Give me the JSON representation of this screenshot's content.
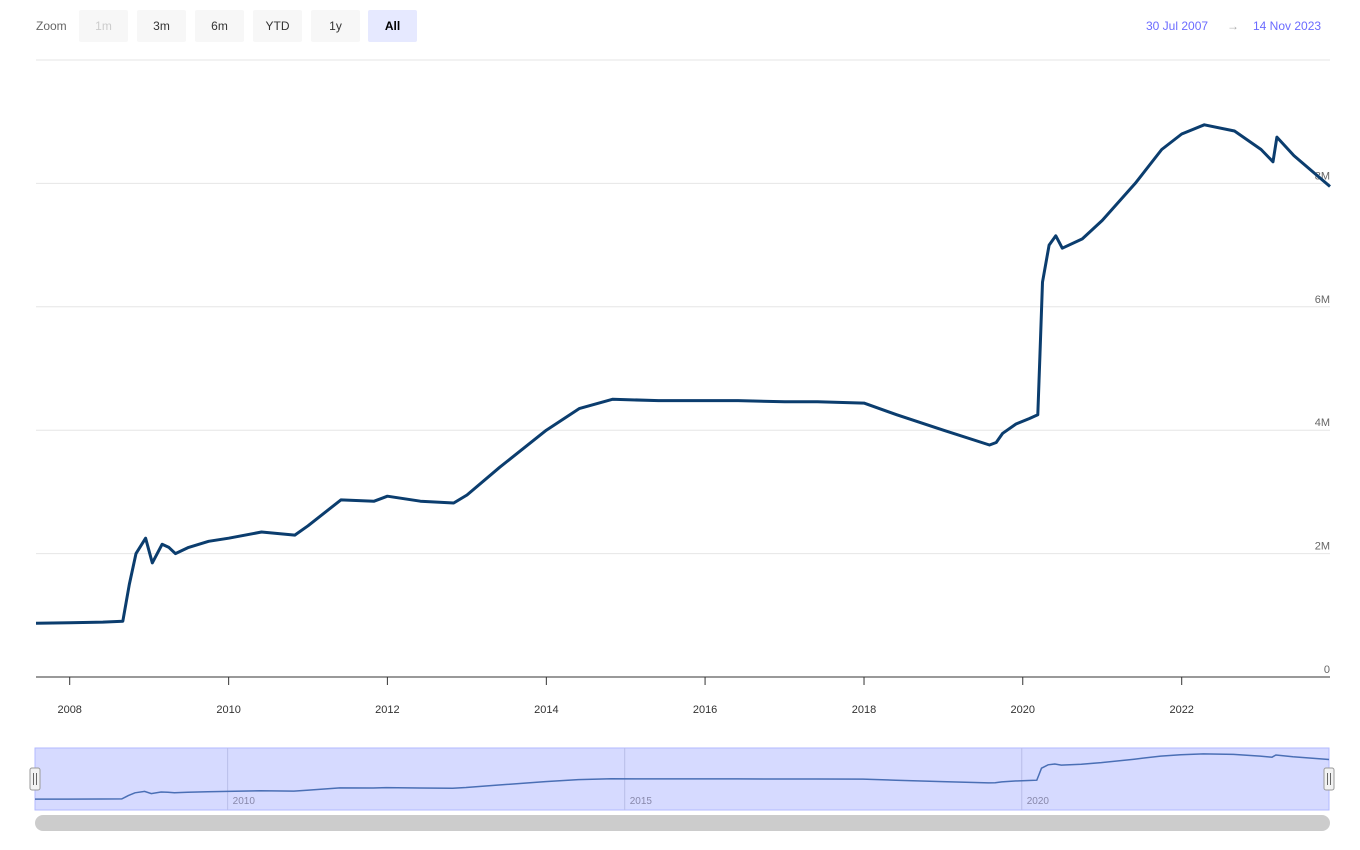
{
  "range_selector": {
    "zoom_label": "Zoom",
    "buttons": [
      {
        "label": "1m",
        "state": "disabled"
      },
      {
        "label": "3m",
        "state": "normal"
      },
      {
        "label": "6m",
        "state": "normal"
      },
      {
        "label": "YTD",
        "state": "normal"
      },
      {
        "label": "1y",
        "state": "normal"
      },
      {
        "label": "All",
        "state": "active"
      }
    ],
    "from_date": "30 Jul 2007",
    "arrow": "→",
    "to_date": "14 Nov 2023"
  },
  "colors": {
    "line": "#0b3d6e",
    "grid": "#e6e6e6",
    "navigator_fill": "#d6daff",
    "navigator_line": "#4a6fb5",
    "scrollbar": "#cccccc",
    "date_text": "#6b6bff"
  },
  "chart_data": {
    "type": "line",
    "title": "",
    "xlabel": "",
    "ylabel": "",
    "x_tick_labels": [
      "2008",
      "2010",
      "2012",
      "2014",
      "2016",
      "2018",
      "2020",
      "2022"
    ],
    "y_tick_labels": [
      "0",
      "2M",
      "4M",
      "6M",
      "8M"
    ],
    "ylim": [
      0,
      10000000
    ],
    "xlim": [
      "2007-07-30",
      "2023-11-14"
    ],
    "grid": "horizontal",
    "navigator_tick_labels": [
      "2010",
      "2015",
      "2020"
    ],
    "series": [
      {
        "x": [
          "2007-07-30",
          "2008-01-01",
          "2008-06-01",
          "2008-09-01",
          "2008-10-01",
          "2008-11-01",
          "2008-12-15",
          "2009-01-15",
          "2009-03-01",
          "2009-04-01",
          "2009-05-01",
          "2009-07-01",
          "2009-10-01",
          "2010-01-01",
          "2010-06-01",
          "2010-11-01",
          "2011-01-01",
          "2011-06-01",
          "2011-11-01",
          "2012-01-01",
          "2012-06-01",
          "2012-11-01",
          "2013-01-01",
          "2013-06-01",
          "2014-01-01",
          "2014-06-01",
          "2014-11-01",
          "2015-06-01",
          "2016-01-01",
          "2016-06-01",
          "2017-01-01",
          "2017-06-01",
          "2018-01-01",
          "2018-06-01",
          "2019-01-01",
          "2019-08-01",
          "2019-09-01",
          "2019-10-01",
          "2019-12-01",
          "2020-02-01",
          "2020-03-10",
          "2020-03-20",
          "2020-04-01",
          "2020-05-01",
          "2020-06-01",
          "2020-07-01",
          "2020-10-01",
          "2021-01-01",
          "2021-06-01",
          "2021-10-01",
          "2022-01-01",
          "2022-04-15",
          "2022-09-01",
          "2023-01-01",
          "2023-02-25",
          "2023-03-15",
          "2023-06-01",
          "2023-11-14"
        ],
        "y": [
          870000,
          880000,
          890000,
          905000,
          1500000,
          2000000,
          2250000,
          1850000,
          2150000,
          2100000,
          2000000,
          2100000,
          2200000,
          2250000,
          2350000,
          2300000,
          2450000,
          2870000,
          2850000,
          2930000,
          2850000,
          2820000,
          2950000,
          3400000,
          4000000,
          4350000,
          4500000,
          4480000,
          4480000,
          4480000,
          4460000,
          4460000,
          4440000,
          4250000,
          4000000,
          3760000,
          3800000,
          3950000,
          4100000,
          4190000,
          4250000,
          5200000,
          6400000,
          7000000,
          7150000,
          6950000,
          7100000,
          7400000,
          8000000,
          8550000,
          8800000,
          8950000,
          8850000,
          8550000,
          8350000,
          8750000,
          8450000,
          7950000
        ]
      }
    ]
  }
}
